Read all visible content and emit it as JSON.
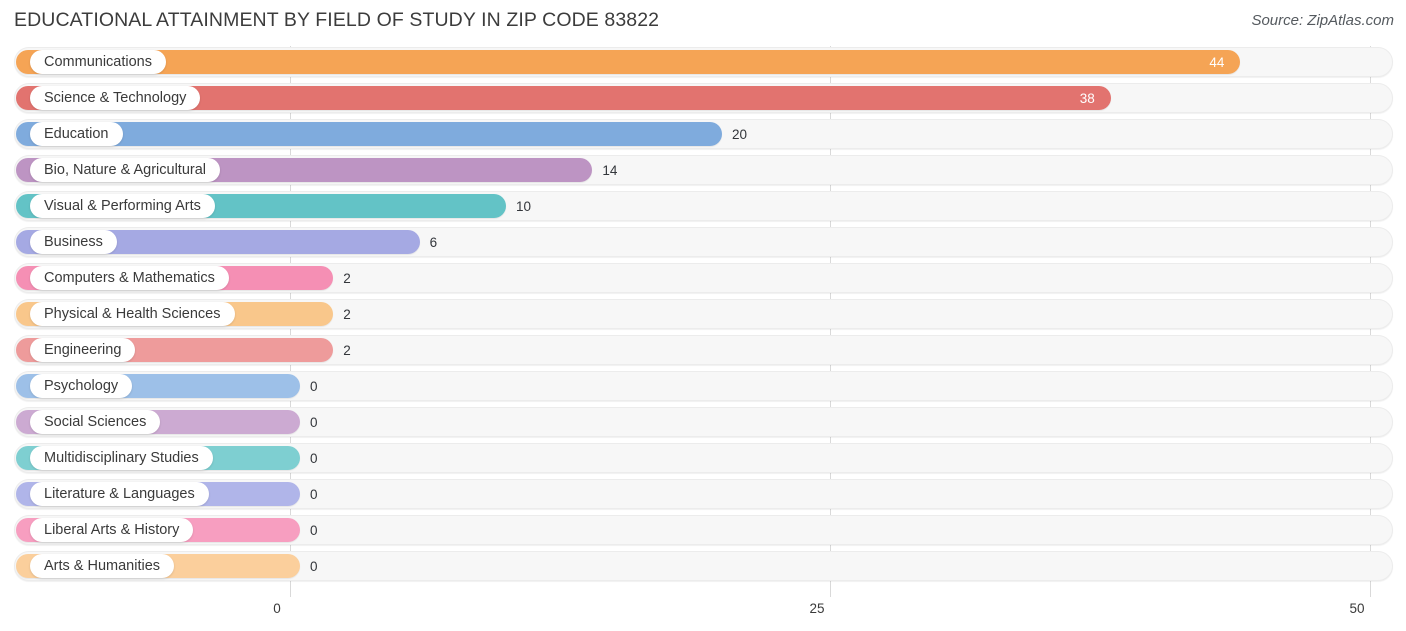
{
  "header": {
    "title": "EDUCATIONAL ATTAINMENT BY FIELD OF STUDY IN ZIP CODE 83822",
    "source": "Source: ZipAtlas.com"
  },
  "chart_data": {
    "type": "bar",
    "orientation": "horizontal",
    "title": "EDUCATIONAL ATTAINMENT BY FIELD OF STUDY IN ZIP CODE 83822",
    "xlabel": "",
    "ylabel": "",
    "xlim": [
      0,
      50
    ],
    "xticks": [
      "0",
      "25",
      "50"
    ],
    "xtick_values": [
      0,
      25,
      50
    ],
    "grid": true,
    "legend": false,
    "categories": [
      "Communications",
      "Science & Technology",
      "Education",
      "Bio, Nature & Agricultural",
      "Visual & Performing Arts",
      "Business",
      "Computers & Mathematics",
      "Physical & Health Sciences",
      "Engineering",
      "Psychology",
      "Social Sciences",
      "Multidisciplinary Studies",
      "Literature & Languages",
      "Liberal Arts & History",
      "Arts & Humanities"
    ],
    "values": [
      44,
      38,
      20,
      14,
      10,
      6,
      2,
      2,
      2,
      0,
      0,
      0,
      0,
      0,
      0
    ],
    "value_labels": [
      "44",
      "38",
      "20",
      "14",
      "10",
      "6",
      "2",
      "2",
      "2",
      "0",
      "0",
      "0",
      "0",
      "0",
      "0"
    ],
    "colors": [
      "#f5a455",
      "#e2736f",
      "#7fabdd",
      "#bd94c3",
      "#63c3c6",
      "#a5a9e3",
      "#f58fb4",
      "#f9c78b",
      "#ee9b9b",
      "#9dc0e8",
      "#ccaad2",
      "#7ecfd1",
      "#b0b5e9",
      "#f79ec0",
      "#fbcf9c"
    ],
    "label_inside_bar": [
      true,
      true,
      false,
      false,
      false,
      false,
      false,
      false,
      false,
      false,
      false,
      false,
      false,
      false,
      false
    ]
  }
}
